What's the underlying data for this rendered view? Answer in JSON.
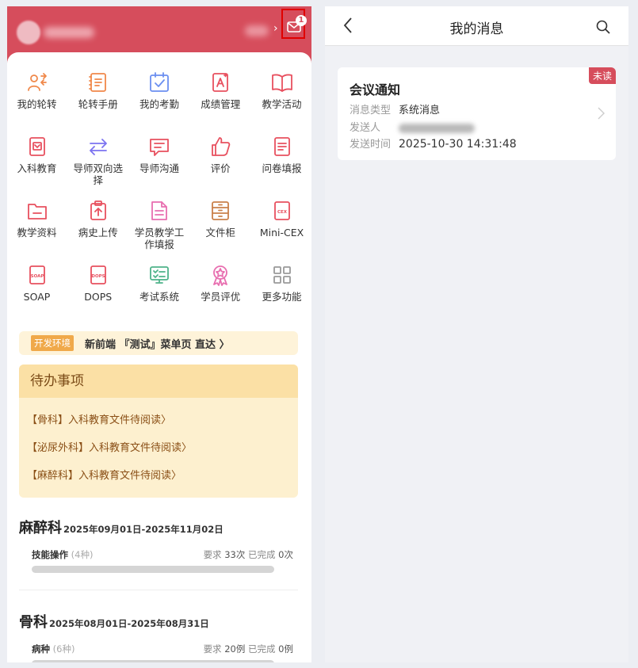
{
  "header": {
    "message_badge": "1"
  },
  "grid": [
    {
      "label": "我的轮转",
      "icon": "rotation-icon",
      "color": "#f0884a"
    },
    {
      "label": "轮转手册",
      "icon": "handbook-icon",
      "color": "#f0884a"
    },
    {
      "label": "我的考勤",
      "icon": "attendance-icon",
      "color": "#6b8ff0"
    },
    {
      "label": "成绩管理",
      "icon": "grades-icon",
      "color": "#e8505f"
    },
    {
      "label": "教学活动",
      "icon": "book-icon",
      "color": "#e8505f"
    },
    {
      "label": "入科教育",
      "icon": "entry-education-icon",
      "color": "#e8505f"
    },
    {
      "label": "导师双向选择",
      "icon": "two-way-select-icon",
      "color": "#7c73f0"
    },
    {
      "label": "导师沟通",
      "icon": "chat-icon",
      "color": "#e8505f"
    },
    {
      "label": "评价",
      "icon": "thumbs-up-icon",
      "color": "#e8505f"
    },
    {
      "label": "问卷填报",
      "icon": "questionnaire-icon",
      "color": "#e8505f"
    },
    {
      "label": "教学资料",
      "icon": "folder-icon",
      "color": "#e8505f"
    },
    {
      "label": "病史上传",
      "icon": "upload-icon",
      "color": "#e8505f"
    },
    {
      "label": "学员教学工作填报",
      "icon": "document-icon",
      "color": "#e86fb0"
    },
    {
      "label": "文件柜",
      "icon": "cabinet-icon",
      "color": "#c9804a"
    },
    {
      "label": "Mini-CEX",
      "icon": "cex-icon",
      "color": "#e8505f"
    },
    {
      "label": "SOAP",
      "icon": "soap-icon",
      "color": "#e8505f"
    },
    {
      "label": "DOPS",
      "icon": "dops-icon",
      "color": "#e8505f"
    },
    {
      "label": "考试系统",
      "icon": "exam-icon",
      "color": "#4fb38a"
    },
    {
      "label": "学员评优",
      "icon": "award-icon",
      "color": "#e86fb0"
    },
    {
      "label": "更多功能",
      "icon": "more-grid-icon",
      "color": "#999999"
    }
  ],
  "env": {
    "tag": "开发环境",
    "text": "新前端 『测试』菜单页 直达 〉"
  },
  "todo": {
    "title": "待办事项",
    "items": [
      "【骨科】入科教育文件待阅读〉",
      "【泌尿外科】入科教育文件待阅读〉",
      "【麻醉科】入科教育文件待阅读〉"
    ]
  },
  "courses": [
    {
      "name": "麻醉科",
      "date": "2025年09月01日-2025年11月02日",
      "item": "技能操作",
      "count": "(4种)",
      "req_label": "要求",
      "req": "33次",
      "done_label": "已完成",
      "done": "0次",
      "progress": 0
    },
    {
      "name": "骨科",
      "date": "2025年08月01日-2025年08月31日",
      "item": "病种",
      "count": "(6种)",
      "req_label": "要求",
      "req": "20例",
      "done_label": "已完成",
      "done": "0例",
      "progress": 0
    }
  ],
  "right": {
    "title": "我的消息",
    "message": {
      "unread": "未读",
      "title": "会议通知",
      "type_label": "消息类型",
      "type": "系统消息",
      "sender_label": "发送人",
      "time_label": "发送时间",
      "time": "2025-10-30 14:31:48"
    }
  }
}
